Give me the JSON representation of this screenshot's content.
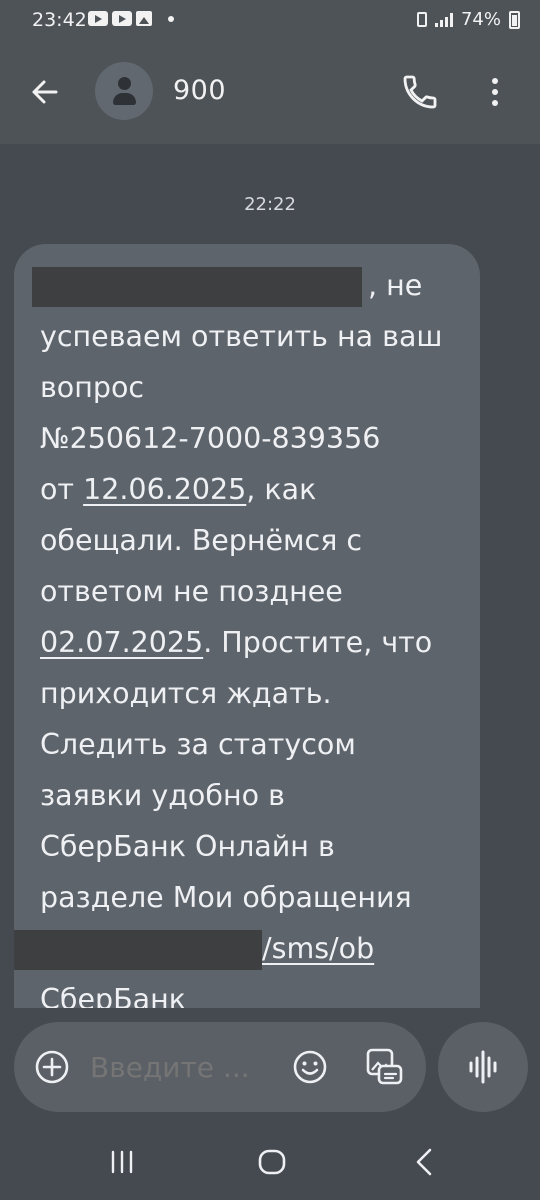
{
  "status_bar": {
    "time": "23:42",
    "battery": "74%"
  },
  "header": {
    "contact_name": "900",
    "icons": [
      "arrow-back-icon",
      "person-icon",
      "phone-icon",
      "more-vert-icon"
    ]
  },
  "conversation": {
    "timestamp": "22:22",
    "message": {
      "line1_after_redaction": ", не",
      "line2": "успеваем ответить на ваш",
      "line3": "вопрос",
      "line4": "№250612-7000-839356",
      "line5_prefix": "от ",
      "date_link_1": "12.06.2025",
      "line5_suffix": ", как",
      "line6": "обещали. Вернёмся с",
      "line7": "ответом не позднее",
      "date_link_2": "02.07.2025",
      "line8_suffix": ". Простите, что",
      "line9": "приходится ждать.",
      "line10": "Следить за статусом",
      "line11": "заявки удобно в",
      "line12": "СберБанк Онлайн в",
      "line13": "разделе Мои обращения",
      "link_tail": "/sms/ob",
      "signature": "СберБанк"
    }
  },
  "compose": {
    "placeholder": "Введите ...",
    "icons": [
      "add-circle-icon",
      "emoji-icon",
      "attach-media-icon",
      "voice-waveform-icon"
    ]
  },
  "navigation": {
    "icons": [
      "recents-icon",
      "home-icon",
      "back-icon"
    ]
  },
  "colors": {
    "background": "#454a50",
    "app_bar": "#4e5358",
    "bubble": "#5e646b",
    "redaction": "#3e3f41"
  }
}
